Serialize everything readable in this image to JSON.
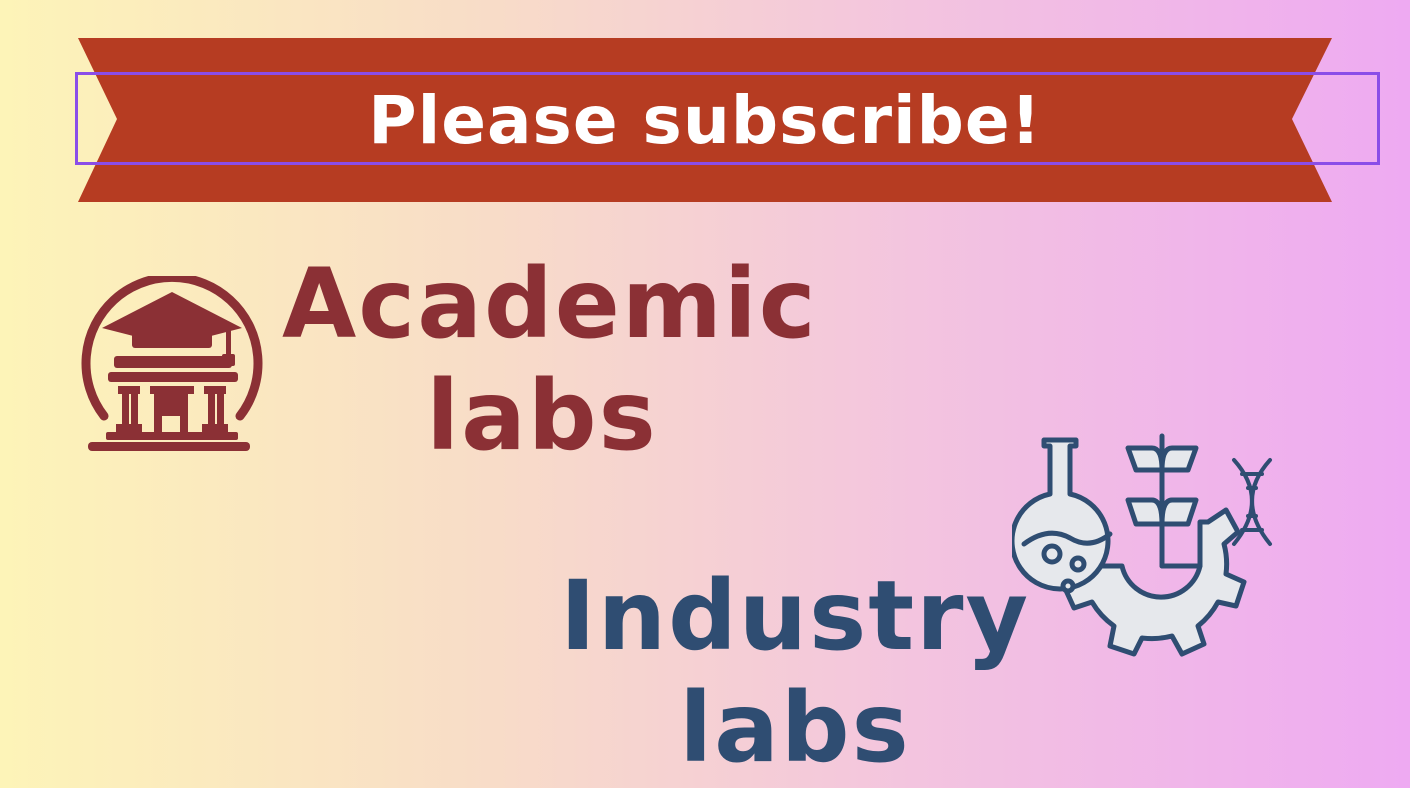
{
  "banner": {
    "text": "Please subscribe!",
    "color": "#b63c22"
  },
  "academic": {
    "line1": "Academic",
    "line2": "labs",
    "color": "#8b3035",
    "icon": "university-building-icon"
  },
  "industry": {
    "line1": "Industry",
    "line2": "labs",
    "color": "#2f4d72",
    "icon": "lab-flask-plant-gear-dna-icon"
  }
}
